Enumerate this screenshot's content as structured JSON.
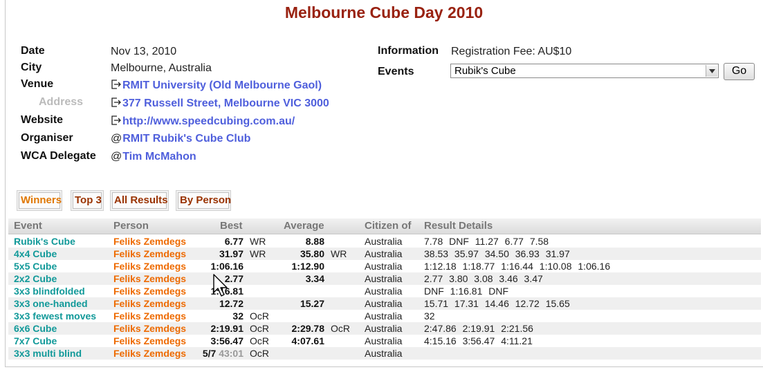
{
  "page_title": "Melbourne Cube Day 2010",
  "info": {
    "date_label": "Date",
    "date_value": "Nov 13, 2010",
    "city_label": "City",
    "city_value": "Melbourne, Australia",
    "venue_label": "Venue",
    "venue_value": "RMIT University (Old Melbourne Gaol)",
    "address_label": "Address",
    "address_value": "377 Russell Street, Melbourne VIC 3000",
    "website_label": "Website",
    "website_value": "http://www.speedcubing.com.au/",
    "organiser_label": "Organiser",
    "organiser_value": "RMIT Rubik's Cube Club",
    "delegate_label": "WCA Delegate",
    "delegate_value": "Tim McMahon",
    "information_label": "Information",
    "information_value": "Registration Fee: AU$10",
    "events_label": "Events",
    "events_selected": "Rubik's Cube",
    "go_label": "Go"
  },
  "icons": {
    "external_link": "external-link-icon",
    "email": "at-sign-icon",
    "dropdown": "chevron-down-icon",
    "cursor": "mouse-cursor-icon"
  },
  "tabs": [
    {
      "label": "Winners",
      "active": true
    },
    {
      "label": "Top 3",
      "active": false
    },
    {
      "label": "All Results",
      "active": false
    },
    {
      "label": "By Person",
      "active": false
    }
  ],
  "table": {
    "headers": {
      "event": "Event",
      "person": "Person",
      "best": "Best",
      "average": "Average",
      "citizen": "Citizen of",
      "details": "Result Details"
    },
    "rows": [
      {
        "event": "Rubik's Cube",
        "person": "Feliks Zemdegs",
        "best": "6.77",
        "best_extra": "",
        "best_record": "WR",
        "average": "8.88",
        "average_record": "",
        "citizen": "Australia",
        "details": "7.78 DNF 11.27 6.77 7.58"
      },
      {
        "event": "4x4 Cube",
        "person": "Feliks Zemdegs",
        "best": "31.97",
        "best_extra": "",
        "best_record": "WR",
        "average": "35.80",
        "average_record": "WR",
        "citizen": "Australia",
        "details": "38.53 35.97 34.50 36.93 31.97"
      },
      {
        "event": "5x5 Cube",
        "person": "Feliks Zemdegs",
        "best": "1:06.16",
        "best_extra": "",
        "best_record": "",
        "average": "1:12.90",
        "average_record": "",
        "citizen": "Australia",
        "details": "1:12.18 1:18.77 1:16.44 1:10.08 1:06.16"
      },
      {
        "event": "2x2 Cube",
        "person": "Feliks Zemdegs",
        "best": "2.77",
        "best_extra": "",
        "best_record": "",
        "average": "3.34",
        "average_record": "",
        "citizen": "Australia",
        "details": "2.77 3.80 3.08 3.46 3.47"
      },
      {
        "event": "3x3 blindfolded",
        "person": "Feliks Zemdegs",
        "best": "1:16.81",
        "best_extra": "",
        "best_record": "",
        "average": "",
        "average_record": "",
        "citizen": "Australia",
        "details": "DNF 1:16.81 DNF"
      },
      {
        "event": "3x3 one-handed",
        "person": "Feliks Zemdegs",
        "best": "12.72",
        "best_extra": "",
        "best_record": "",
        "average": "15.27",
        "average_record": "",
        "citizen": "Australia",
        "details": "15.71 17.31 14.46 12.72 15.65"
      },
      {
        "event": "3x3 fewest moves",
        "person": "Feliks Zemdegs",
        "best": "32",
        "best_extra": "",
        "best_record": "OcR",
        "average": "",
        "average_record": "",
        "citizen": "Australia",
        "details": "32"
      },
      {
        "event": "6x6 Cube",
        "person": "Feliks Zemdegs",
        "best": "2:19.91",
        "best_extra": "",
        "best_record": "OcR",
        "average": "2:29.78",
        "average_record": "OcR",
        "citizen": "Australia",
        "details": "2:47.86 2:19.91 2:21.56"
      },
      {
        "event": "7x7 Cube",
        "person": "Feliks Zemdegs",
        "best": "3:56.47",
        "best_extra": "",
        "best_record": "OcR",
        "average": "4:07.61",
        "average_record": "",
        "citizen": "Australia",
        "details": "4:15.16 3:56.47 4:11.21"
      },
      {
        "event": "3x3 multi blind",
        "person": "Feliks Zemdegs",
        "best": "5/7",
        "best_extra": "43:01",
        "best_record": "OcR",
        "average": "",
        "average_record": "",
        "citizen": "Australia",
        "details": ""
      }
    ]
  }
}
